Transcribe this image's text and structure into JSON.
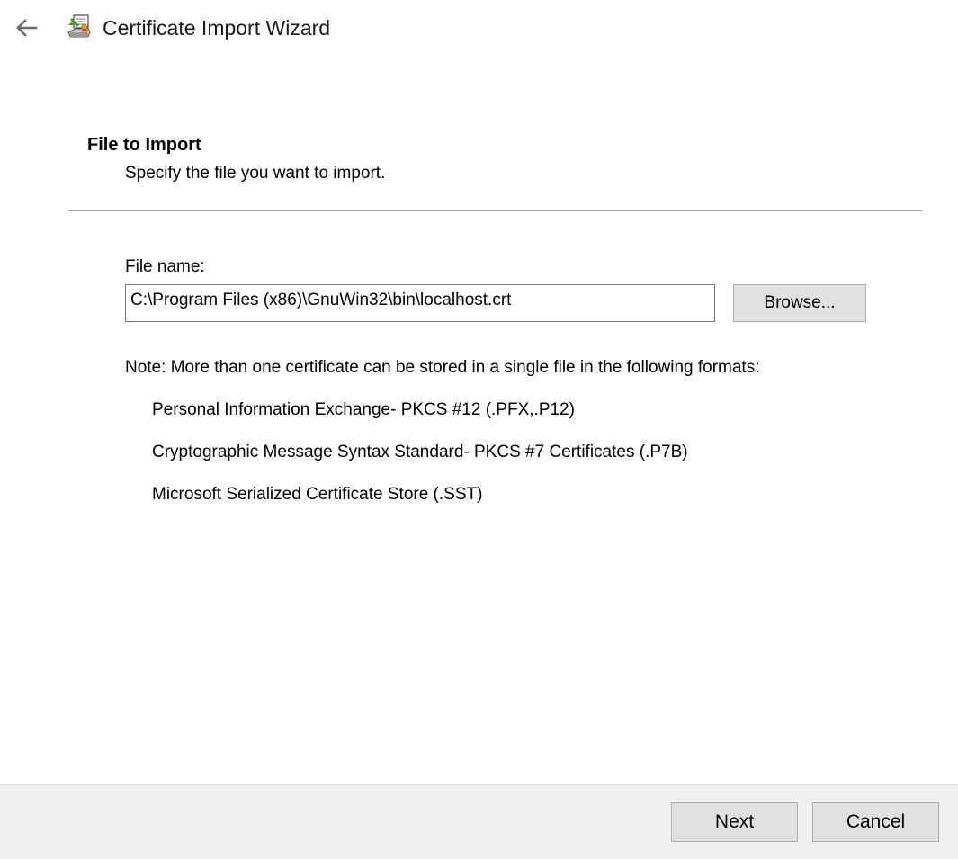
{
  "window": {
    "title": "Certificate Import Wizard",
    "back_icon": "back-arrow-icon",
    "wizard_icon": "certificate-wizard-icon"
  },
  "header": {
    "title": "File to Import",
    "subtitle": "Specify the file you want to import."
  },
  "file": {
    "label": "File name:",
    "value": "C:\\Program Files (x86)\\GnuWin32\\bin\\localhost.crt",
    "browse_label": "Browse..."
  },
  "note": {
    "text": "Note:  More than one certificate can be stored in a single file in the following formats:",
    "formats": [
      "Personal Information Exchange- PKCS #12 (.PFX,.P12)",
      "Cryptographic Message Syntax Standard- PKCS #7 Certificates (.P7B)",
      "Microsoft Serialized Certificate Store (.SST)"
    ]
  },
  "footer": {
    "next_label": "Next",
    "cancel_label": "Cancel"
  },
  "colors": {
    "footer_bg": "#f0f0f0",
    "button_bg": "#e1e1e1",
    "button_border": "#adadad",
    "divider": "#a0a0a0"
  }
}
